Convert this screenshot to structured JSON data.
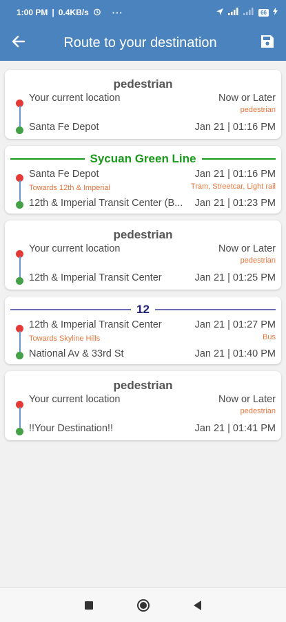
{
  "status_bar": {
    "time": "1:00 PM",
    "speed": "0.4KB/s",
    "dots": "···",
    "battery": "66"
  },
  "app_bar": {
    "title": "Route to your destination",
    "back_icon": "arrow-left-icon",
    "save_icon": "floppy-disk-icon"
  },
  "colors": {
    "primary": "#4a83bd",
    "accent_orange": "#e8773e",
    "start_dot": "#e53935",
    "end_dot": "#43a047",
    "green_line": "#1a9a1a",
    "bus_line": "#24237a"
  },
  "legs": [
    {
      "kind": "walk",
      "title": "pedestrian",
      "from": "Your current location",
      "from_time": "Now or Later",
      "mode": "pedestrian",
      "to": "Santa Fe Depot",
      "to_time": "Jan 21 | 01:16 PM"
    },
    {
      "kind": "transit",
      "title": "Sycuan Green Line",
      "from": "Santa Fe Depot",
      "from_time": "Jan 21 | 01:16 PM",
      "direction": "Towards 12th & Imperial",
      "mode": "Tram, Streetcar, Light rail",
      "to": "12th & Imperial Transit Center (B...",
      "to_time": "Jan 21 | 01:23 PM"
    },
    {
      "kind": "walk",
      "title": "pedestrian",
      "from": "Your current location",
      "from_time": "Now or Later",
      "mode": "pedestrian",
      "to": "12th & Imperial Transit Center",
      "to_time": "Jan 21 | 01:25 PM"
    },
    {
      "kind": "transit",
      "title": "12",
      "from": "12th & Imperial Transit Center",
      "from_time": "Jan 21 | 01:27 PM",
      "direction": "Towards Skyline Hills",
      "mode": "Bus",
      "to": "National Av & 33rd St",
      "to_time": "Jan 21 | 01:40 PM"
    },
    {
      "kind": "walk",
      "title": "pedestrian",
      "from": "Your current location",
      "from_time": "Now or Later",
      "mode": "pedestrian",
      "to": "!!Your Destination!!",
      "to_time": "Jan 21 | 01:41 PM"
    }
  ],
  "nav_bar": {
    "recents_icon": "square-icon",
    "home_icon": "circle-home-icon",
    "back_icon": "triangle-back-icon"
  }
}
